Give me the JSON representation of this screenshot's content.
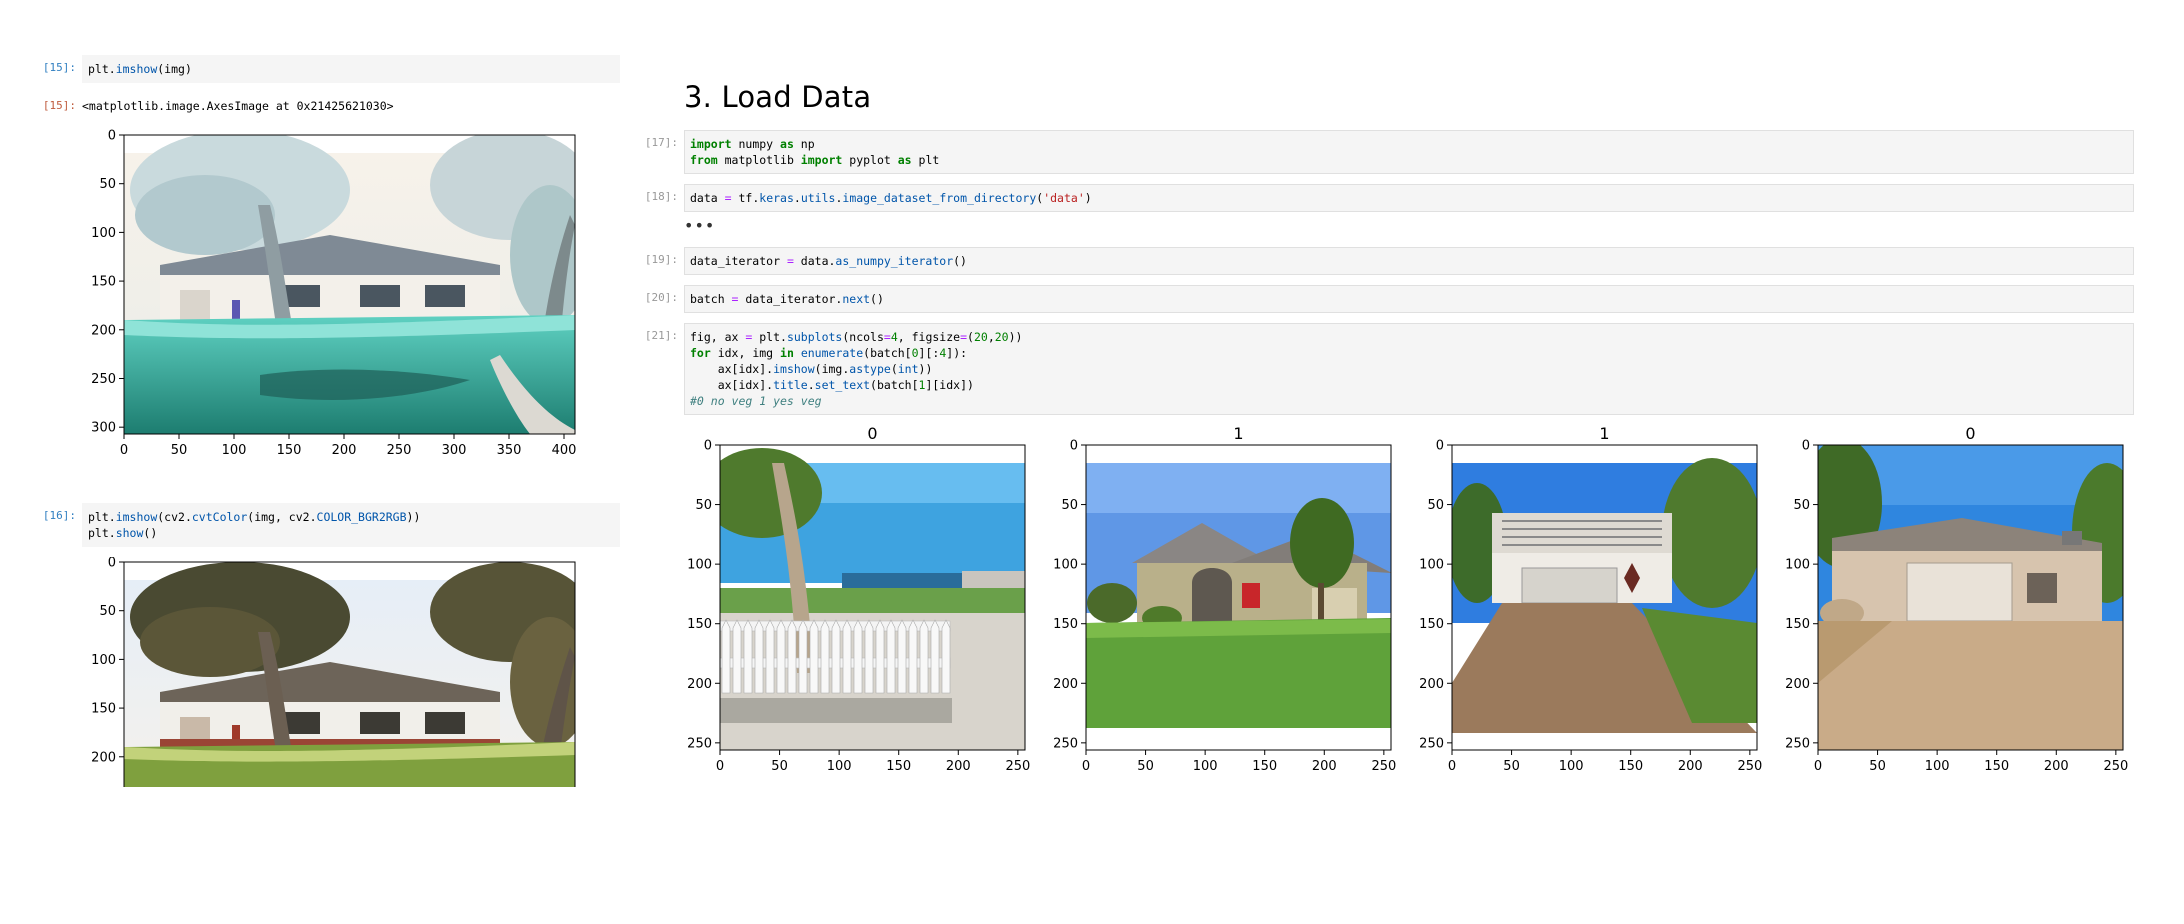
{
  "left": {
    "cell15": {
      "in_prompt": "[15]:",
      "code": "plt.imshow(img)",
      "out_prompt": "[15]:",
      "output": "<matplotlib.image.AxesImage at 0x21425621030>",
      "xticks": [
        "0",
        "50",
        "100",
        "150",
        "200",
        "250",
        "300",
        "350",
        "400"
      ],
      "yticks": [
        "0",
        "50",
        "100",
        "150",
        "200",
        "250",
        "300"
      ]
    },
    "cell16": {
      "in_prompt": "[16]:",
      "code_line1": "plt.imshow(cv2.cvtColor(img, cv2.COLOR_BGR2RGB))",
      "code_line2": "plt.show()",
      "yticks": [
        "0",
        "50",
        "100",
        "150",
        "200"
      ]
    }
  },
  "right": {
    "heading": "3. Load Data",
    "cell17": {
      "prompt": "[17]:",
      "line1": "import numpy as np",
      "line2": "from matplotlib import pyplot as plt"
    },
    "cell18": {
      "prompt": "[18]:",
      "code": "data = tf.keras.utils.image_dataset_from_directory('data')",
      "ellipsis": "•••"
    },
    "cell19": {
      "prompt": "[19]:",
      "code": "data_iterator = data.as_numpy_iterator()"
    },
    "cell20": {
      "prompt": "[20]:",
      "code": "batch = data_iterator.next()"
    },
    "cell21": {
      "prompt": "[21]:",
      "lines": [
        "fig, ax = plt.subplots(ncols=4, figsize=(20,20))",
        "for idx, img in enumerate(batch[0][:4]):",
        "    ax[idx].imshow(img.astype(int))",
        "    ax[idx].title.set_text(batch[1][idx])",
        "#0 no veg 1 yes veg"
      ]
    },
    "subplots": {
      "titles": [
        "0",
        "1",
        "1",
        "0"
      ],
      "xticks": [
        "0",
        "50",
        "100",
        "150",
        "200",
        "250"
      ],
      "yticks": [
        "0",
        "50",
        "100",
        "150",
        "200",
        "250"
      ]
    }
  },
  "colors": {
    "prompt_in": "#307fc1",
    "prompt_out": "#bf5b3d",
    "cell_bg": "#f5f5f5",
    "keyword": "#008000",
    "string": "#ba2121"
  }
}
